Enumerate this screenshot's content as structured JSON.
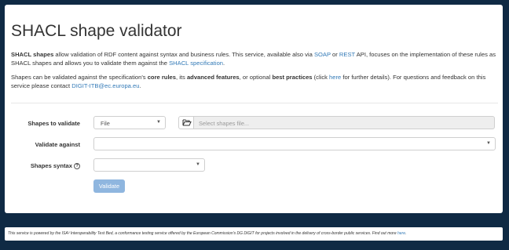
{
  "page": {
    "title": "SHACL shape validator"
  },
  "intro": {
    "p1_bold": "SHACL shapes",
    "p1_a": " allow validation of RDF content against syntax and business rules. This service, available also via ",
    "soap_link": "SOAP",
    "p1_b": " or ",
    "rest_link": "REST",
    "p1_c": " API, focuses on the implementation of these rules as SHACL shapes and allows you to validate them against the ",
    "spec_link": "SHACL specification",
    "p1_d": ".",
    "p2_a": "Shapes can be validated against the specification's ",
    "p2_core": "core rules",
    "p2_b": ", its ",
    "p2_adv": "advanced features",
    "p2_c": ", or optional ",
    "p2_best": "best practices",
    "p2_d": " (click ",
    "here_link": "here",
    "p2_e": " for further details). For questions and feedback on this service please contact ",
    "email_link": "DIGIT-ITB@ec.europa.eu",
    "p2_f": "."
  },
  "form": {
    "shapes_label": "Shapes to validate",
    "shapes_source": "File",
    "file_placeholder": "Select shapes file...",
    "validate_against_label": "Validate against",
    "validate_against_value": "",
    "syntax_label": "Shapes syntax",
    "syntax_value": "",
    "validate_button": "Validate"
  },
  "footer": {
    "text": "This service is powered by the ISA² Interoperability Test Bed, a conformance testing service offered by the European Commission's DG DIGIT for projects involved in the delivery of cross-border public services. Find out more ",
    "link": "here",
    "end": "."
  },
  "colors": {
    "frame": "#0f2a44",
    "link": "#337ab7",
    "button": "#8fb6df"
  }
}
